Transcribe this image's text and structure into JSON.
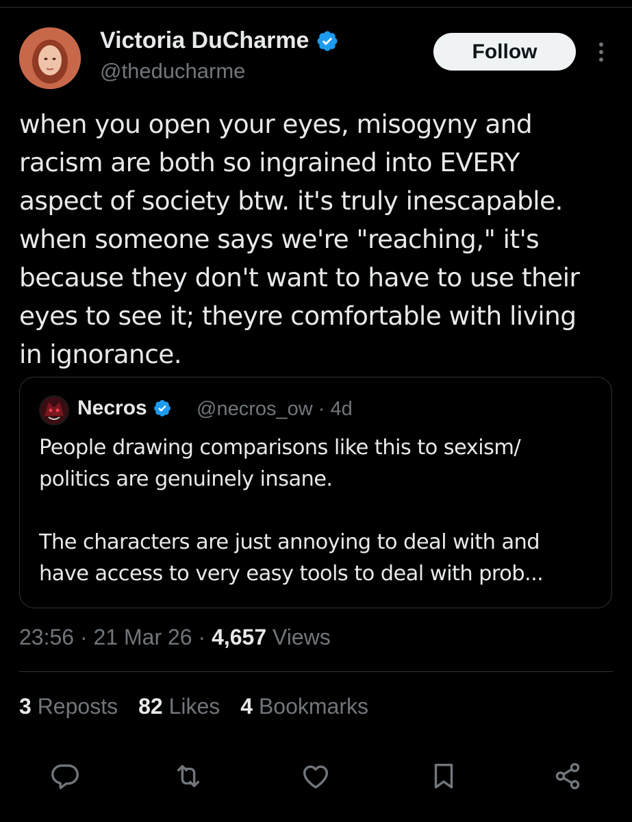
{
  "author": {
    "name": "Victoria DuCharme",
    "handle": "@theducharme",
    "avatar_icon": "profile-photo",
    "verified_icon": "verified-badge-icon"
  },
  "header": {
    "follow_label": "Follow",
    "more_icon": "more-vertical-icon"
  },
  "tweet": {
    "text": "when you open your eyes, misogyny and\nracism are both so ingrained into EVERY\naspect of society btw. it's truly inescapable.\nwhen someone says we're \"reaching,\" it's\nbecause they don't want to have to use their\neyes to see it; theyre comfortable with living\nin ignorance."
  },
  "quote": {
    "name": "Necros",
    "handle_time": "@necros_ow · 4d",
    "text": "People drawing comparisons like this to sexism/\npolitics are genuinely insane.\n\nThe characters are just annoying to deal with and\nhave access to very easy tools to deal with prob..."
  },
  "meta": {
    "time": "23:56",
    "sep1": " · ",
    "date": "21 Mar 26",
    "sep2": " · ",
    "views_count": "4,657",
    "views_label": " Views"
  },
  "stats": {
    "reposts_count": "3",
    "reposts_label": " Reposts",
    "likes_count": "82",
    "likes_label": " Likes",
    "bookmarks_count": "4",
    "bookmarks_label": " Bookmarks"
  },
  "actions": [
    "reply-icon",
    "repost-icon",
    "like-icon",
    "bookmark-icon",
    "share-icon"
  ],
  "colors": {
    "background": "#000000",
    "text": "#e7e9ea",
    "secondary": "#71767b",
    "verified": "#1d9bf0",
    "divider": "#2f3336"
  }
}
